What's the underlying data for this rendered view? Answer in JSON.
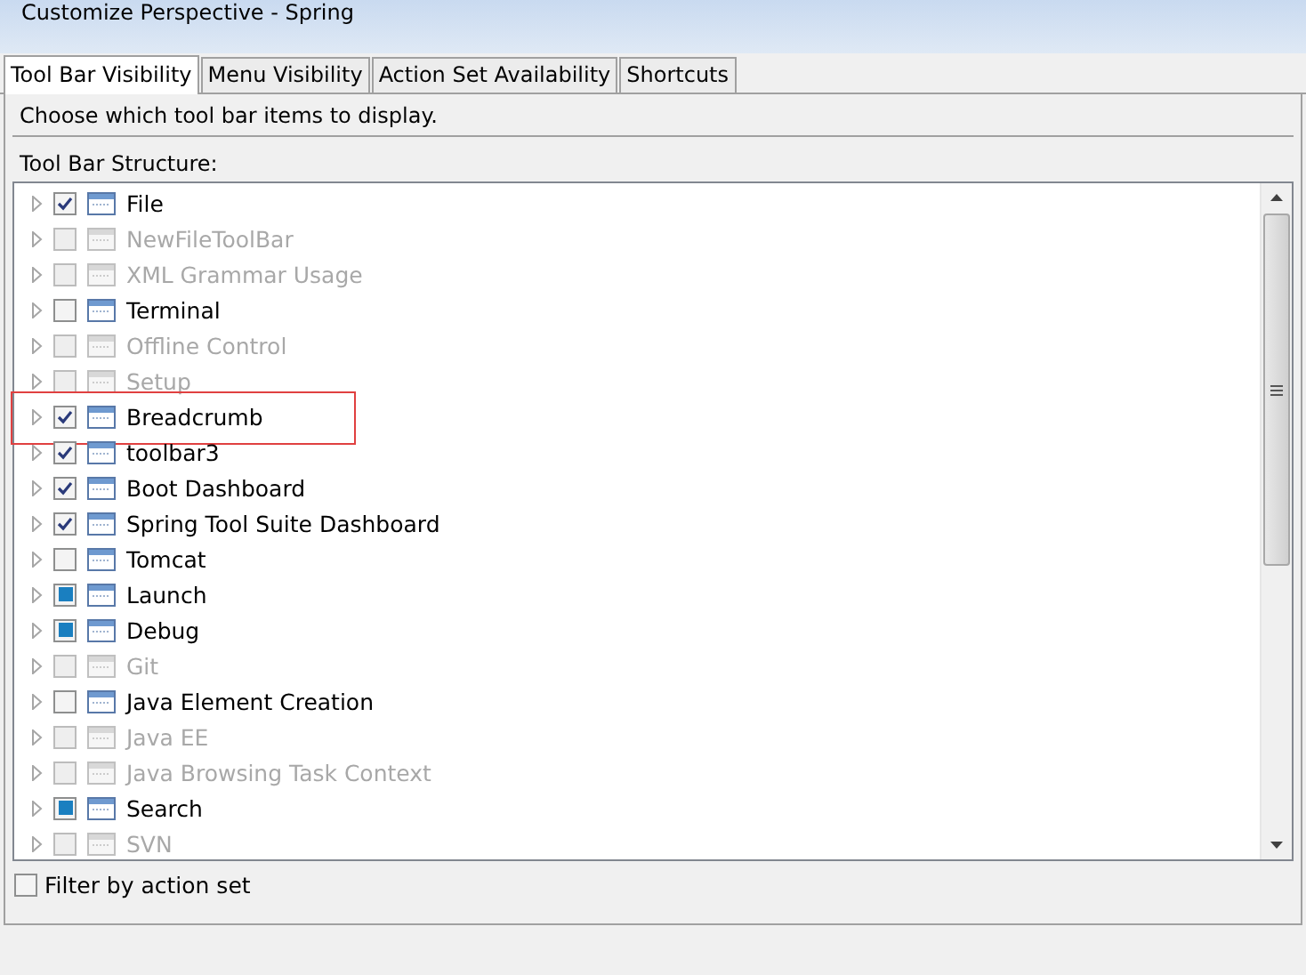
{
  "window": {
    "title": "Customize Perspective - Spring"
  },
  "tabs": [
    {
      "label": "Tool Bar Visibility",
      "selected": true
    },
    {
      "label": "Menu Visibility",
      "selected": false
    },
    {
      "label": "Action Set Availability",
      "selected": false
    },
    {
      "label": "Shortcuts",
      "selected": false
    }
  ],
  "instruction": "Choose which tool bar items to display.",
  "structure_label": "Tool Bar Structure:",
  "tree_items": [
    {
      "label": "File",
      "checked": true,
      "mixed": false,
      "disabled": false,
      "highlighted": false
    },
    {
      "label": "NewFileToolBar",
      "checked": false,
      "mixed": false,
      "disabled": true,
      "highlighted": false
    },
    {
      "label": "XML Grammar Usage",
      "checked": false,
      "mixed": false,
      "disabled": true,
      "highlighted": false
    },
    {
      "label": "Terminal",
      "checked": false,
      "mixed": false,
      "disabled": false,
      "highlighted": false
    },
    {
      "label": "Offline Control",
      "checked": false,
      "mixed": false,
      "disabled": true,
      "highlighted": false
    },
    {
      "label": "Setup",
      "checked": false,
      "mixed": false,
      "disabled": true,
      "highlighted": false
    },
    {
      "label": "Breadcrumb",
      "checked": true,
      "mixed": false,
      "disabled": false,
      "highlighted": true
    },
    {
      "label": "toolbar3",
      "checked": true,
      "mixed": false,
      "disabled": false,
      "highlighted": false
    },
    {
      "label": "Boot Dashboard",
      "checked": true,
      "mixed": false,
      "disabled": false,
      "highlighted": false
    },
    {
      "label": "Spring Tool Suite Dashboard",
      "checked": true,
      "mixed": false,
      "disabled": false,
      "highlighted": false
    },
    {
      "label": "Tomcat",
      "checked": false,
      "mixed": false,
      "disabled": false,
      "highlighted": false
    },
    {
      "label": "Launch",
      "checked": true,
      "mixed": true,
      "disabled": false,
      "highlighted": false
    },
    {
      "label": "Debug",
      "checked": true,
      "mixed": true,
      "disabled": false,
      "highlighted": false
    },
    {
      "label": "Git",
      "checked": false,
      "mixed": false,
      "disabled": true,
      "highlighted": false
    },
    {
      "label": "Java Element Creation",
      "checked": false,
      "mixed": false,
      "disabled": false,
      "highlighted": false
    },
    {
      "label": "Java EE",
      "checked": false,
      "mixed": false,
      "disabled": true,
      "highlighted": false
    },
    {
      "label": "Java Browsing Task Context",
      "checked": false,
      "mixed": false,
      "disabled": true,
      "highlighted": false
    },
    {
      "label": "Search",
      "checked": true,
      "mixed": true,
      "disabled": false,
      "highlighted": false
    },
    {
      "label": "SVN",
      "checked": false,
      "mixed": false,
      "disabled": true,
      "highlighted": false
    }
  ],
  "filter": {
    "label": "Filter by action set",
    "checked": false
  }
}
